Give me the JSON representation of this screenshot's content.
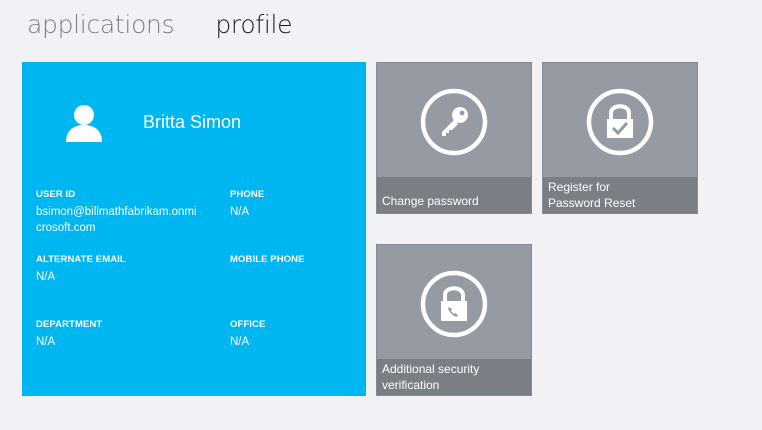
{
  "nav": {
    "tabs": [
      {
        "label": "applications",
        "active": false
      },
      {
        "label": "profile",
        "active": true
      }
    ]
  },
  "profile": {
    "name": "Britta Simon",
    "avatar_icon": "user-icon",
    "fields": {
      "user_id": {
        "label": "USER ID",
        "value": "bsimon@billmathfabrikam.onmicrosoft.com"
      },
      "phone": {
        "label": "PHONE",
        "value": "N/A"
      },
      "alternate_email": {
        "label": "ALTERNATE EMAIL",
        "value": "N/A"
      },
      "mobile_phone": {
        "label": "MOBILE PHONE",
        "value": ""
      },
      "department": {
        "label": "DEPARTMENT",
        "value": "N/A"
      },
      "office": {
        "label": "OFFICE",
        "value": "N/A"
      }
    }
  },
  "tiles": {
    "change_password": {
      "label": "Change password",
      "icon": "key-icon"
    },
    "register_reset": {
      "label_line1": "Register for",
      "label_line2": "Password Reset",
      "icon": "lock-check-icon"
    },
    "security_verification": {
      "label_line1": "Additional security",
      "label_line2": "verification",
      "icon": "lock-phone-icon"
    }
  },
  "colors": {
    "profile_card": "#00b6f0",
    "tile": "#959aa3",
    "tile_label_band": "#7a7f86",
    "background": "#f2f2f6"
  }
}
